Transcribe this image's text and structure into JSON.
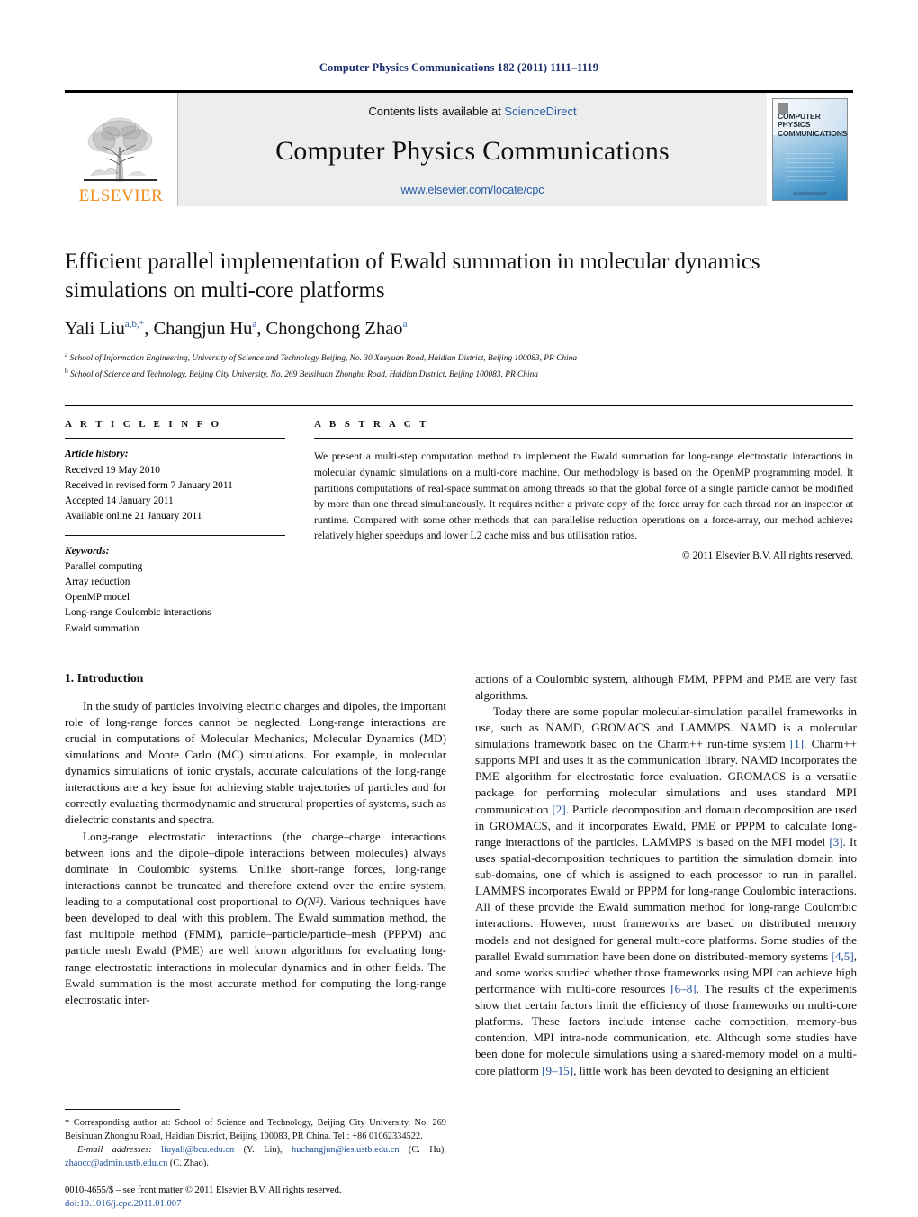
{
  "running_head": "Computer Physics Communications 182 (2011) 1111–1119",
  "banner": {
    "publisher_name": "ELSEVIER",
    "contents_prefix": "Contents lists available at",
    "contents_link": "ScienceDirect",
    "journal_title": "Computer Physics Communications",
    "journal_url": "www.elsevier.com/locate/cpc",
    "cover_title_line1": "COMPUTER PHYSICS",
    "cover_title_line2": "COMMUNICATIONS"
  },
  "article": {
    "title": "Efficient parallel implementation of Ewald summation in molecular dynamics simulations on multi-core platforms",
    "authors_html": "Yali Liu<sup>a,b,</sup><sup>*</sup>, Changjun Hu<sup>a</sup>, Chongchong Zhao<sup>a</sup>",
    "affiliation_a": "School of Information Engineering, University of Science and Technology Beijing, No. 30 Xueyuan Road, Haidian District, Beijing 100083, PR China",
    "affiliation_b": "School of Science and Technology, Beijing City University, No. 269 Beisihuan Zhonghu Road, Haidian District, Beijing 100083, PR China"
  },
  "article_info": {
    "heading": "A R T I C L E    I N F O",
    "history_label": "Article history:",
    "history": [
      "Received 19 May 2010",
      "Received in revised form 7 January 2011",
      "Accepted 14 January 2011",
      "Available online 21 January 2011"
    ],
    "keywords_label": "Keywords:",
    "keywords": [
      "Parallel computing",
      "Array reduction",
      "OpenMP model",
      "Long-range Coulombic interactions",
      "Ewald summation"
    ]
  },
  "abstract": {
    "heading": "A B S T R A C T",
    "text": "We present a multi-step computation method to implement the Ewald summation for long-range electrostatic interactions in molecular dynamic simulations on a multi-core machine. Our methodology is based on the OpenMP programming model. It partitions computations of real-space summation among threads so that the global force of a single particle cannot be modified by more than one thread simultaneously. It requires neither a private copy of the force array for each thread nor an inspector at runtime. Compared with some other methods that can parallelise reduction operations on a force-array, our method achieves relatively higher speedups and lower L2 cache miss and bus utilisation ratios.",
    "copyright": "© 2011 Elsevier B.V. All rights reserved."
  },
  "body": {
    "section_number_title": "1. Introduction",
    "left_paragraphs": [
      "In the study of particles involving electric charges and dipoles, the important role of long-range forces cannot be neglected. Long-range interactions are crucial in computations of Molecular Mechanics, Molecular Dynamics (MD) simulations and Monte Carlo (MC) simulations. For example, in molecular dynamics simulations of ionic crystals, accurate calculations of the long-range interactions are a key issue for achieving stable trajectories of particles and for correctly evaluating thermodynamic and structural properties of systems, such as dielectric constants and spectra."
    ],
    "left_paragraph_2_part1": "Long-range electrostatic interactions (the charge–charge interactions between ions and the dipole–dipole interactions between molecules) always dominate in Coulombic systems. Unlike short-range forces, long-range interactions cannot be truncated and therefore extend over the entire system, leading to a computational cost proportional to ",
    "left_paragraph_2_math": "O(N²)",
    "left_paragraph_2_part2": ". Various techniques have been developed to deal with this problem. The Ewald summation method, the fast multipole method (FMM), particle–particle/particle–mesh (PPPM) and particle mesh Ewald (PME) are well known algorithms for evaluating long-range electrostatic interactions in molecular dynamics and in other fields. The Ewald summation is the most accurate method for computing the long-range electrostatic inter-",
    "right_paragraph_1": "actions of a Coulombic system, although FMM, PPPM and PME are very fast algorithms.",
    "right_p2_s1": "Today there are some popular molecular-simulation parallel frameworks in use, such as NAMD, GROMACS and LAMMPS. NAMD is a molecular simulations framework based on the Charm++ run-time system ",
    "right_p2_c1": "[1]",
    "right_p2_s2": ". Charm++ supports MPI and uses it as the communication library. NAMD incorporates the PME algorithm for electrostatic force evaluation. GROMACS is a versatile package for performing molecular simulations and uses standard MPI communication ",
    "right_p2_c2": "[2]",
    "right_p2_s3": ". Particle decomposition and domain decomposition are used in GROMACS, and it incorporates Ewald, PME or PPPM to calculate long-range interactions of the particles. LAMMPS is based on the MPI model ",
    "right_p2_c3": "[3]",
    "right_p2_s4": ". It uses spatial-decomposition techniques to partition the simulation domain into sub-domains, one of which is assigned to each processor to run in parallel. LAMMPS incorporates Ewald or PPPM for long-range Coulombic interactions. All of these provide the Ewald summation method for long-range Coulombic interactions. However, most frameworks are based on distributed memory models and not designed for general multi-core platforms. Some studies of the parallel Ewald summation have been done on distributed-memory systems ",
    "right_p2_c4": "[4,5]",
    "right_p2_s5": ", and some works studied whether those frameworks using MPI can achieve high performance with multi-core resources ",
    "right_p2_c5": "[6–8]",
    "right_p2_s6": ". The results of the experiments show that certain factors limit the efficiency of those frameworks on multi-core platforms. These factors include intense cache competition, memory-bus contention, MPI intra-node communication, etc. Although some studies have been done for molecule simulations using a shared-memory model on a multi-core platform ",
    "right_p2_c6": "[9–15]",
    "right_p2_s7": ", little work has been devoted to designing an efficient"
  },
  "footnotes": {
    "corresponding_marker": "*",
    "corresponding_text": "Corresponding author at: School of Science and Technology, Beijing City University, No. 269 Beisihuan Zhonghu Road, Haidian District, Beijing 100083, PR China. Tel.: +86 01062334522.",
    "email_label": "E-mail addresses:",
    "email_1": "liuyali@bcu.edu.cn",
    "email_1_owner": "(Y. Liu),",
    "email_2": "huchangjun@ies.ustb.edu.cn",
    "email_2_owner": "(C. Hu),",
    "email_3": "zhaocc@admin.ustb.edu.cn",
    "email_3_owner": "(C. Zhao).",
    "imprint": "0010-4655/$ – see front matter © 2011 Elsevier B.V. All rights reserved.",
    "doi": "doi:10.1016/j.cpc.2011.01.007"
  },
  "colors": {
    "link_blue": "#2a5caa",
    "cite_blue": "#1f4f9c",
    "running_head_blue": "#1c2f6e",
    "elsevier_orange": "#f08c1c",
    "banner_gray": "#eceded"
  }
}
